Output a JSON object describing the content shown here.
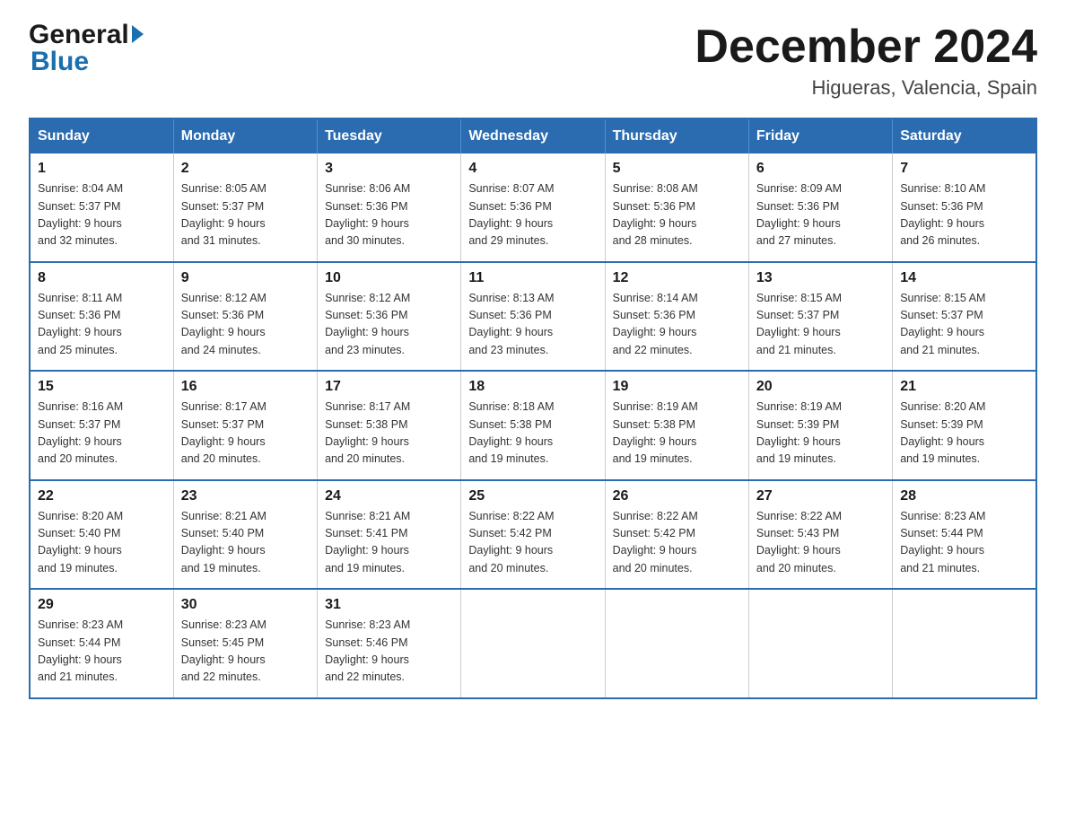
{
  "logo": {
    "general": "General",
    "blue": "Blue"
  },
  "header": {
    "month": "December 2024",
    "location": "Higueras, Valencia, Spain"
  },
  "weekdays": [
    "Sunday",
    "Monday",
    "Tuesday",
    "Wednesday",
    "Thursday",
    "Friday",
    "Saturday"
  ],
  "weeks": [
    [
      {
        "day": "1",
        "sunrise": "8:04 AM",
        "sunset": "5:37 PM",
        "daylight": "9 hours and 32 minutes."
      },
      {
        "day": "2",
        "sunrise": "8:05 AM",
        "sunset": "5:37 PM",
        "daylight": "9 hours and 31 minutes."
      },
      {
        "day": "3",
        "sunrise": "8:06 AM",
        "sunset": "5:36 PM",
        "daylight": "9 hours and 30 minutes."
      },
      {
        "day": "4",
        "sunrise": "8:07 AM",
        "sunset": "5:36 PM",
        "daylight": "9 hours and 29 minutes."
      },
      {
        "day": "5",
        "sunrise": "8:08 AM",
        "sunset": "5:36 PM",
        "daylight": "9 hours and 28 minutes."
      },
      {
        "day": "6",
        "sunrise": "8:09 AM",
        "sunset": "5:36 PM",
        "daylight": "9 hours and 27 minutes."
      },
      {
        "day": "7",
        "sunrise": "8:10 AM",
        "sunset": "5:36 PM",
        "daylight": "9 hours and 26 minutes."
      }
    ],
    [
      {
        "day": "8",
        "sunrise": "8:11 AM",
        "sunset": "5:36 PM",
        "daylight": "9 hours and 25 minutes."
      },
      {
        "day": "9",
        "sunrise": "8:12 AM",
        "sunset": "5:36 PM",
        "daylight": "9 hours and 24 minutes."
      },
      {
        "day": "10",
        "sunrise": "8:12 AM",
        "sunset": "5:36 PM",
        "daylight": "9 hours and 23 minutes."
      },
      {
        "day": "11",
        "sunrise": "8:13 AM",
        "sunset": "5:36 PM",
        "daylight": "9 hours and 23 minutes."
      },
      {
        "day": "12",
        "sunrise": "8:14 AM",
        "sunset": "5:36 PM",
        "daylight": "9 hours and 22 minutes."
      },
      {
        "day": "13",
        "sunrise": "8:15 AM",
        "sunset": "5:37 PM",
        "daylight": "9 hours and 21 minutes."
      },
      {
        "day": "14",
        "sunrise": "8:15 AM",
        "sunset": "5:37 PM",
        "daylight": "9 hours and 21 minutes."
      }
    ],
    [
      {
        "day": "15",
        "sunrise": "8:16 AM",
        "sunset": "5:37 PM",
        "daylight": "9 hours and 20 minutes."
      },
      {
        "day": "16",
        "sunrise": "8:17 AM",
        "sunset": "5:37 PM",
        "daylight": "9 hours and 20 minutes."
      },
      {
        "day": "17",
        "sunrise": "8:17 AM",
        "sunset": "5:38 PM",
        "daylight": "9 hours and 20 minutes."
      },
      {
        "day": "18",
        "sunrise": "8:18 AM",
        "sunset": "5:38 PM",
        "daylight": "9 hours and 19 minutes."
      },
      {
        "day": "19",
        "sunrise": "8:19 AM",
        "sunset": "5:38 PM",
        "daylight": "9 hours and 19 minutes."
      },
      {
        "day": "20",
        "sunrise": "8:19 AM",
        "sunset": "5:39 PM",
        "daylight": "9 hours and 19 minutes."
      },
      {
        "day": "21",
        "sunrise": "8:20 AM",
        "sunset": "5:39 PM",
        "daylight": "9 hours and 19 minutes."
      }
    ],
    [
      {
        "day": "22",
        "sunrise": "8:20 AM",
        "sunset": "5:40 PM",
        "daylight": "9 hours and 19 minutes."
      },
      {
        "day": "23",
        "sunrise": "8:21 AM",
        "sunset": "5:40 PM",
        "daylight": "9 hours and 19 minutes."
      },
      {
        "day": "24",
        "sunrise": "8:21 AM",
        "sunset": "5:41 PM",
        "daylight": "9 hours and 19 minutes."
      },
      {
        "day": "25",
        "sunrise": "8:22 AM",
        "sunset": "5:42 PM",
        "daylight": "9 hours and 20 minutes."
      },
      {
        "day": "26",
        "sunrise": "8:22 AM",
        "sunset": "5:42 PM",
        "daylight": "9 hours and 20 minutes."
      },
      {
        "day": "27",
        "sunrise": "8:22 AM",
        "sunset": "5:43 PM",
        "daylight": "9 hours and 20 minutes."
      },
      {
        "day": "28",
        "sunrise": "8:23 AM",
        "sunset": "5:44 PM",
        "daylight": "9 hours and 21 minutes."
      }
    ],
    [
      {
        "day": "29",
        "sunrise": "8:23 AM",
        "sunset": "5:44 PM",
        "daylight": "9 hours and 21 minutes."
      },
      {
        "day": "30",
        "sunrise": "8:23 AM",
        "sunset": "5:45 PM",
        "daylight": "9 hours and 22 minutes."
      },
      {
        "day": "31",
        "sunrise": "8:23 AM",
        "sunset": "5:46 PM",
        "daylight": "9 hours and 22 minutes."
      },
      null,
      null,
      null,
      null
    ]
  ],
  "labels": {
    "sunrise": "Sunrise:",
    "sunset": "Sunset:",
    "daylight": "Daylight:"
  }
}
